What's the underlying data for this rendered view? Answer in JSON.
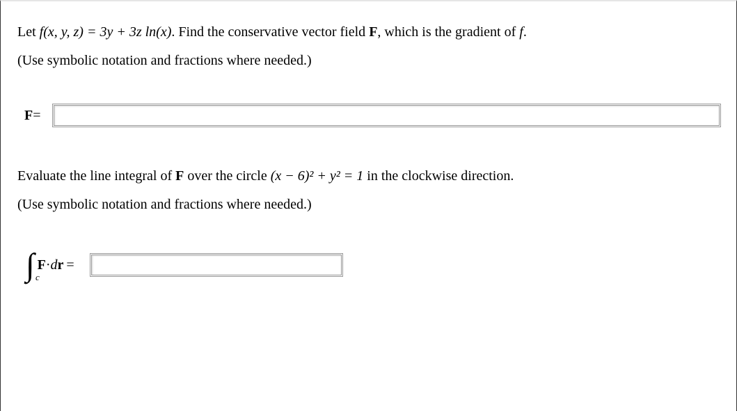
{
  "question1": {
    "text_before_f": "Let ",
    "function_def": "f(x, y, z) = 3y + 3z ln(x)",
    "text_after_f": ". Find the conservative vector field ",
    "vector_F": "F",
    "text_gradient": ", which is the gradient of ",
    "f_symbol": "f",
    "period": "."
  },
  "instruction": "(Use symbolic notation and fractions where needed.)",
  "answer1": {
    "label_F": "F",
    "equals": " = "
  },
  "question2": {
    "text_before": "Evaluate the line integral of ",
    "vector_F": "F",
    "text_circle": " over the circle ",
    "equation": "(x − 6)² + y² = 1",
    "text_direction": " in the clockwise direction."
  },
  "answer2": {
    "integral": "∫",
    "sub_c": "c",
    "F": "F",
    "dot": " · ",
    "dr": "dr",
    "equals": " = "
  }
}
